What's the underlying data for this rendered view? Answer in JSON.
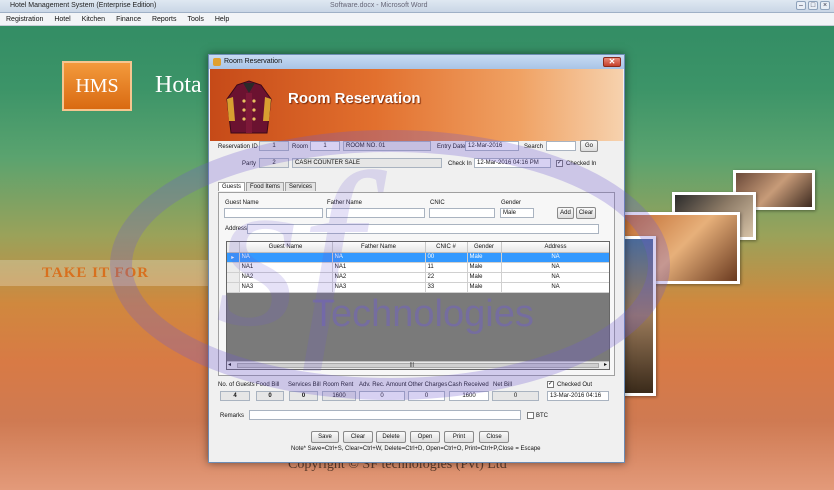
{
  "app": {
    "title": "Hotel Management System (Enterprise Edition)",
    "ghost_title": "Software.docx - Microsoft Word",
    "menu": [
      "Registration",
      "Hotel",
      "Kitchen",
      "Finance",
      "Reports",
      "Tools",
      "Help"
    ]
  },
  "background": {
    "logo": "HMS",
    "hotel_text": "Hota",
    "tagline": "TAKE IT FOR",
    "copyright": "Copyright © SF technologies (Pvt) Ltd",
    "watermark": "Technologies",
    "watermark_sf": "sf"
  },
  "dialog": {
    "title": "Room Reservation",
    "banner_title": "Room Reservation",
    "close": "✕",
    "reservation_id_label": "Reservation ID",
    "reservation_id": "1",
    "room_label": "Room",
    "room_id": "1",
    "room_name": "ROOM NO. 01",
    "entry_date_label": "Entry Date",
    "entry_date": "12-Mar-2016",
    "search_label": "Search",
    "search_value": "",
    "go_label": "Go",
    "party_label": "Party",
    "party_id": "2",
    "party_name": "CASH COUNTER SALE",
    "check_in_label": "Check In",
    "check_in": "12-Mar-2016 04:16 PM",
    "checked_in_label": "Checked In",
    "checked_in": "✓",
    "tabs": [
      "Guests",
      "Food Items",
      "Services"
    ],
    "guest_name_label": "Guest Name",
    "father_name_label": "Father Name",
    "cnic_label": "CNIC",
    "gender_label": "Gender",
    "gender_value": "Male",
    "add_label": "Add",
    "clear_small_label": "Clear",
    "address_label": "Address",
    "grid": {
      "columns": [
        "Guest Name",
        "Father Name",
        "CNIC #",
        "Gender",
        "Address"
      ],
      "rows": [
        {
          "marker": "▸",
          "guest": "NA",
          "father": "NA",
          "cnic": "00",
          "gender": "Male",
          "address": "NA"
        },
        {
          "marker": "",
          "guest": "NA1",
          "father": "NA1",
          "cnic": "11",
          "gender": "Male",
          "address": "NA"
        },
        {
          "marker": "",
          "guest": "NA2",
          "father": "NA2",
          "cnic": "22",
          "gender": "Male",
          "address": "NA"
        },
        {
          "marker": "",
          "guest": "NA3",
          "father": "NA3",
          "cnic": "33",
          "gender": "Male",
          "address": "NA"
        }
      ],
      "scroll_left": "◂",
      "scroll_right": "▸",
      "scroll_grip": "|||"
    },
    "totals": {
      "no_guests_label": "No. of Guests",
      "no_guests": "4",
      "food_bill_label": "Food Bill",
      "food_bill": "0",
      "services_bill_label": "Services Bill",
      "services_bill": "0",
      "room_rent_label": "Room Rent",
      "room_rent": "1600",
      "adv_rec_label": "Adv. Rec. Amount",
      "adv_rec": "0",
      "other_charges_label": "Other Charges",
      "other_charges": "0",
      "cash_received_label": "Cash Received",
      "cash_received": "1600",
      "net_bill_label": "Net Bill",
      "net_bill": "0"
    },
    "checked_out_label": "Checked Out",
    "checked_out": "✓",
    "check_out_date": "13-Mar-2016 04:16",
    "remarks_label": "Remarks",
    "remarks": "",
    "btc_label": "BTC",
    "buttons": [
      "Save",
      "Clear",
      "Delete",
      "Open",
      "Print",
      "Close"
    ],
    "footnote": "Note* Save=Ctrl+S, Clear=Ctrl+W, Delete=Ctrl+D, Open=Ctrl+O, Print=Ctrl+P,Close = Escape"
  },
  "colors": {
    "banner_start": "#c64a18",
    "banner_end": "#f6d2ae",
    "selection": "#3399ff",
    "watermark": "#6e5ad2"
  }
}
